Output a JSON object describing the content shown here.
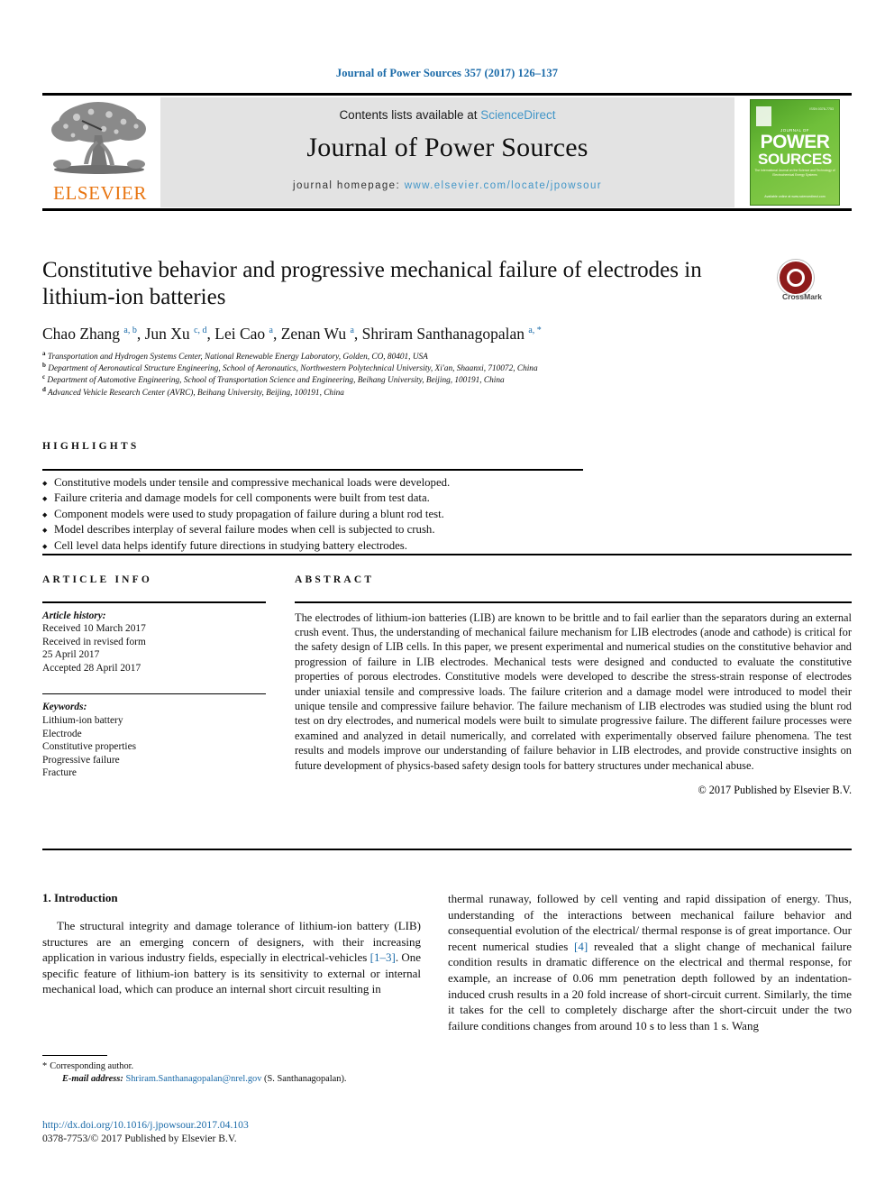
{
  "running_head": "Journal of Power Sources 357 (2017) 126–137",
  "masthead": {
    "contents_prefix": "Contents lists available at ",
    "contents_link": "ScienceDirect",
    "journal_title": "Journal of Power Sources",
    "homepage_prefix": "journal homepage: ",
    "homepage_url": "www.elsevier.com/locate/jpowsour",
    "publisher_wordmark": "ELSEVIER",
    "cover": {
      "top_line": "JOURNAL OF",
      "power": "POWER",
      "sources": "SOURCES",
      "sub": "The International Journal on the Science and Technology of Electrochemical Energy Systems",
      "issn": "ISSN 0378-7753",
      "foot": "Available online at\nwww.sciencedirect.com"
    }
  },
  "article": {
    "title": "Constitutive behavior and progressive mechanical failure of electrodes in lithium-ion batteries",
    "crossmark_label": "CrossMark",
    "authors": [
      {
        "name": "Chao Zhang",
        "marks": "a, b",
        "sep": ", "
      },
      {
        "name": "Jun Xu",
        "marks": "c, d",
        "sep": ", "
      },
      {
        "name": "Lei Cao",
        "marks": "a",
        "sep": ", "
      },
      {
        "name": "Zenan Wu",
        "marks": "a",
        "sep": ", "
      },
      {
        "name": "Shriram Santhanagopalan",
        "marks": "a, *",
        "sep": ""
      }
    ],
    "affiliations": [
      {
        "mark": "a",
        "text": "Transportation and Hydrogen Systems Center, National Renewable Energy Laboratory, Golden, CO, 80401, USA"
      },
      {
        "mark": "b",
        "text": "Department of Aeronautical Structure Engineering, School of Aeronautics, Northwestern Polytechnical University, Xi'an, Shaanxi, 710072, China"
      },
      {
        "mark": "c",
        "text": "Department of Automotive Engineering, School of Transportation Science and Engineering, Beihang University, Beijing, 100191, China"
      },
      {
        "mark": "d",
        "text": "Advanced Vehicle Research Center (AVRC), Beihang University, Beijing, 100191, China"
      }
    ]
  },
  "highlights": {
    "label": "HIGHLIGHTS",
    "items": [
      "Constitutive models under tensile and compressive mechanical loads were developed.",
      "Failure criteria and damage models for cell components were built from test data.",
      "Component models were used to study propagation of failure during a blunt rod test.",
      "Model describes interplay of several failure modes when cell is subjected to crush.",
      "Cell level data helps identify future directions in studying battery electrodes."
    ]
  },
  "article_info": {
    "label": "ARTICLE INFO",
    "history_lead": "Article history:",
    "history_lines": [
      "Received 10 March 2017",
      "Received in revised form",
      "25 April 2017",
      "Accepted 28 April 2017"
    ],
    "keywords_lead": "Keywords:",
    "keywords": [
      "Lithium-ion battery",
      "Electrode",
      "Constitutive properties",
      "Progressive failure",
      "Fracture"
    ]
  },
  "abstract": {
    "label": "ABSTRACT",
    "text": "The electrodes of lithium-ion batteries (LIB) are known to be brittle and to fail earlier than the separators during an external crush event. Thus, the understanding of mechanical failure mechanism for LIB electrodes (anode and cathode) is critical for the safety design of LIB cells. In this paper, we present experimental and numerical studies on the constitutive behavior and progression of failure in LIB electrodes. Mechanical tests were designed and conducted to evaluate the constitutive properties of porous electrodes. Constitutive models were developed to describe the stress-strain response of electrodes under uniaxial tensile and compressive loads. The failure criterion and a damage model were introduced to model their unique tensile and compressive failure behavior. The failure mechanism of LIB electrodes was studied using the blunt rod test on dry electrodes, and numerical models were built to simulate progressive failure. The different failure processes were examined and analyzed in detail numerically, and correlated with experimentally observed failure phenomena. The test results and models improve our understanding of failure behavior in LIB electrodes, and provide constructive insights on future development of physics-based safety design tools for battery structures under mechanical abuse.",
    "copyright": "© 2017 Published by Elsevier B.V."
  },
  "body": {
    "section_heading": "1. Introduction",
    "left_para_1": "The structural integrity and damage tolerance of lithium-ion battery (LIB) structures are an emerging concern of designers, with their increasing application in various industry fields, especially in electrical-vehicles ",
    "left_ref_1": "[1–3]",
    "left_para_1b": ". One specific feature of lithium-ion battery is its sensitivity to external or internal mechanical load, which can produce an internal short circuit resulting in",
    "right_para_1": "thermal runaway, followed by cell venting and rapid dissipation of energy. Thus, understanding of the interactions between mechanical failure behavior and consequential evolution of the electrical/ thermal response is of great importance. Our recent numerical studies ",
    "right_ref_1": "[4]",
    "right_para_1b": " revealed that a slight change of mechanical failure condition results in dramatic difference on the electrical and thermal response, for example, an increase of 0.06 mm penetration depth followed by an indentation-induced crush results in a 20 fold increase of short-circuit current. Similarly, the time it takes for the cell to completely discharge after the short-circuit under the two failure conditions changes from around 10 s to less than 1 s. Wang"
  },
  "footnote": {
    "star": "*",
    "corresponding": "Corresponding author.",
    "email_lead": "E-mail address:",
    "email": "Shriram.Santhanagopalan@nrel.gov",
    "email_suffix": "(S. Santhanagopalan)."
  },
  "doc_footer": {
    "doi": "http://dx.doi.org/10.1016/j.jpowsour.2017.04.103",
    "issn": "0378-7753/© 2017 Published by Elsevier B.V."
  },
  "colors": {
    "link": "#1a6aa8",
    "science_direct": "#4296c8",
    "elsevier_orange": "#e87511",
    "band_gray": "#e3e3e3",
    "crossmark_red": "#8e1b1b",
    "cover_green": "#6fbf3a"
  }
}
